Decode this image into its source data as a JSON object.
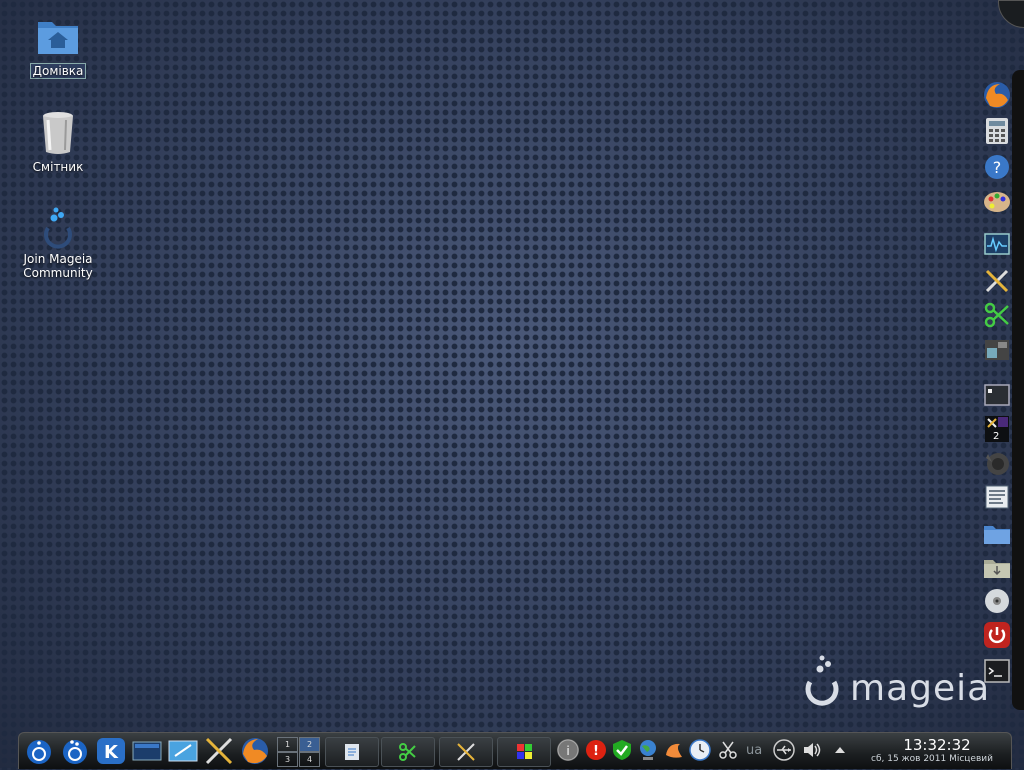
{
  "desktop": {
    "icons": [
      {
        "label": "Домівка",
        "icon": "home-folder-icon"
      },
      {
        "label": "Смітник",
        "icon": "trash-icon"
      },
      {
        "label": "Join Mageia Community",
        "icon": "mageia-community-icon"
      }
    ],
    "logo_text": "mageia"
  },
  "dock": {
    "items": [
      "firefox-icon",
      "calculator-icon",
      "help-icon",
      "paint-palette-icon",
      "system-monitor-icon",
      "tools-icon",
      "network-icon",
      "video-editor-icon",
      "terminal-window-icon",
      "workspace-icon",
      "gimp-icon",
      "document-viewer-icon",
      "folder-icon",
      "download-folder-icon",
      "cd-disc-icon",
      "power-icon",
      "terminal-icon"
    ],
    "workspace_number": "2"
  },
  "panel": {
    "launchers": [
      "mageia-menu-icon",
      "mageia-control-center-icon",
      "kde-menu-icon",
      "show-desktop-icon",
      "screenshot-icon",
      "tools-icon",
      "firefox-icon"
    ],
    "pager": [
      "1",
      "2",
      "3",
      "4"
    ],
    "tasks": [
      "notes-task",
      "network-task",
      "tools-task",
      "windows-task"
    ],
    "tray": [
      "info-icon",
      "alert-icon",
      "update-ok-icon",
      "network-globe-icon",
      "weather-icon",
      "clock-icon",
      "clipboard-scissors-icon",
      "usb-icon",
      "volume-icon",
      "expand-tray-icon"
    ],
    "keyboard_layout": "ua",
    "clock": {
      "time": "13:32:32",
      "date": "сб, 15 жов 2011 Місцевий"
    }
  },
  "colors": {
    "accent": "#3a78c8",
    "panel_bg": "#1b1e20"
  }
}
